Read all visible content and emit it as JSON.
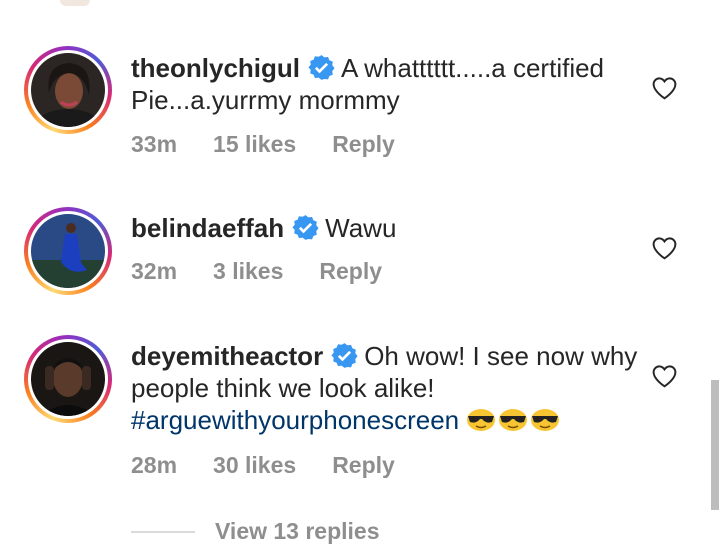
{
  "comments": [
    {
      "username": "theonlychigul",
      "text": "A whatttttt.....a certified Pie...a.yurrmy mormmy",
      "time": "33m",
      "likes": "15 likes",
      "reply": "Reply"
    },
    {
      "username": "belindaeffah",
      "text": "Wawu",
      "time": "32m",
      "likes": "3 likes",
      "reply": "Reply"
    },
    {
      "username": "deyemitheactor",
      "text": "Oh wow! I see now why people think we look alike!",
      "hashtag": "#arguewithyourphonescreen",
      "time": "28m",
      "likes": "30 likes",
      "reply": "Reply"
    }
  ],
  "view_replies": "View 13 replies",
  "icons": {
    "verified": "verified-badge-icon",
    "like": "heart-outline-icon",
    "emoji": "smiling-face-with-sunglasses"
  },
  "colors": {
    "verified": "#3897f0",
    "hashtag": "#003569",
    "meta": "#8e8e8e"
  }
}
